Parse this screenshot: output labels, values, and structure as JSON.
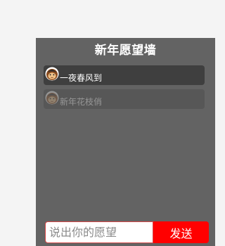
{
  "header": {
    "title": "新年愿望墙"
  },
  "wishes": [
    {
      "text": "一夜春风到",
      "avatar_icon": "monkey-avatar-icon"
    },
    {
      "text": "新年花枝俏",
      "avatar_icon": "monkey-avatar-icon"
    }
  ],
  "composer": {
    "placeholder": "说出你的愿望",
    "send_label": "发送"
  },
  "colors": {
    "page_background": "#f4f4f4",
    "panel_background": "#636363",
    "wish_background": "#3f3f3f",
    "send_button": "#ff0000",
    "input_border": "#d64848"
  }
}
